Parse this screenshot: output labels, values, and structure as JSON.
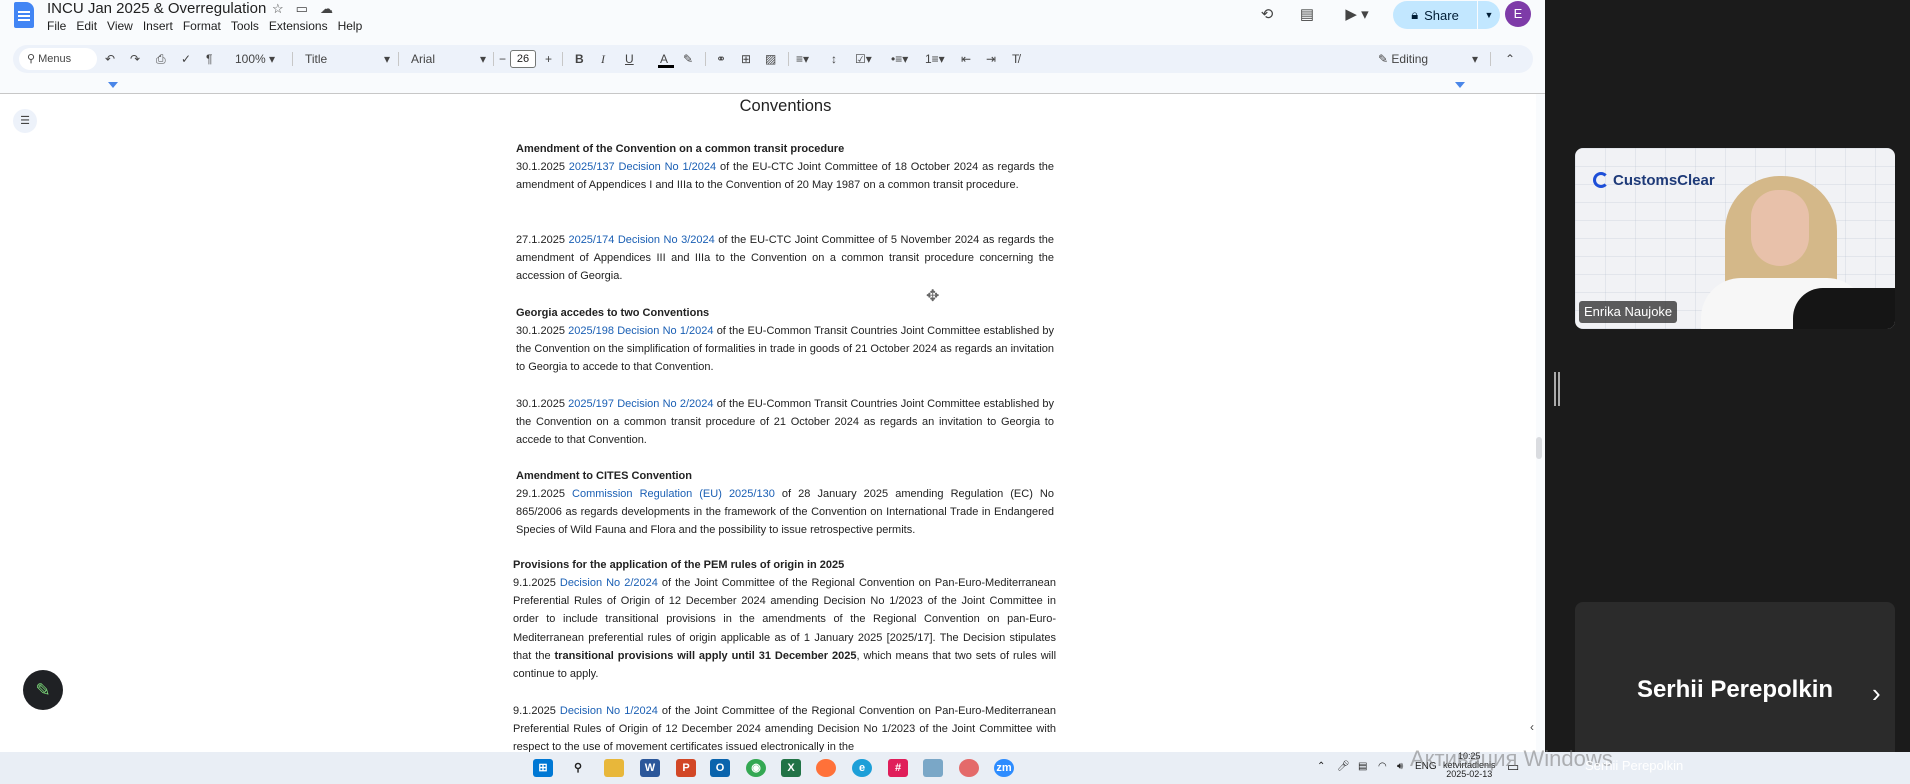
{
  "window": {
    "title": "INCU Jan 2025 & Overregulation",
    "menu": [
      "File",
      "Edit",
      "View",
      "Insert",
      "Format",
      "Tools",
      "Extensions",
      "Help"
    ],
    "share_label": "Share",
    "avatar_letter": "E"
  },
  "toolbar": {
    "menus_label": "Menus",
    "zoom": "100%",
    "style": "Title",
    "font": "Arial",
    "font_size": "26",
    "mode": "Editing"
  },
  "document": {
    "heading": "Conventions",
    "sections": [
      {
        "title": "Amendment of the Convention on a common transit procedure",
        "entries": [
          {
            "date": "30.1.2025",
            "link": "2025/137 Decision No 1/2024",
            "text": "of the EU-CTC Joint Committee of 18 October 2024 as regards the amendment of Appendices I and IIIa to the Convention of 20 May 1987 on a common transit procedure."
          },
          {
            "date": "27.1.2025",
            "link": "2025/174 Decision No 3/2024",
            "text": "of the EU-CTC Joint Committee of 5 November 2024 as regards the amendment of Appendices III and IIIa to the Convention on a common transit procedure concerning the accession of Georgia."
          }
        ]
      },
      {
        "title": "Georgia accedes to two Conventions",
        "entries": [
          {
            "date": "30.1.2025",
            "link": "2025/198 Decision No 1/2024",
            "text": "of the EU-Common Transit Countries Joint Committee established by the Convention on the simplification of formalities in trade in goods of 21 October 2024 as regards an invitation to Georgia to accede to that Convention."
          },
          {
            "date": "30.1.2025",
            "link": "2025/197 Decision No 2/2024",
            "text": "of the EU-Common Transit Countries Joint Committee established by the Convention on a common transit procedure of 21 October 2024 as regards an invitation to Georgia to accede to that Convention."
          }
        ]
      },
      {
        "title": "Amendment to CITES Convention",
        "entries": [
          {
            "date": "29.1.2025",
            "link": "Commission Regulation (EU) 2025/130",
            "text": "of 28 January 2025 amending Regulation (EC) No 865/2006 as regards developments in the framework of the Convention on International Trade in Endangered Species of Wild Fauna and Flora and the possibility to issue retrospective permits."
          }
        ]
      },
      {
        "title": "Provisions for the application of the PEM rules of origin in 2025",
        "entries": [
          {
            "date": "9.1.2025",
            "link": "Decision No 2/2024",
            "text": "of the Joint Committee of the Regional Convention on Pan-Euro-Mediterranean Preferential Rules of Origin of 12 December 2024 amending Decision No 1/2023 of the Joint Committee in order to include transitional provisions in the amendments of the Regional Convention on pan-Euro-Mediterranean preferential rules of origin applicable as of 1 January 2025 [2025/17]. The Decision stipulates that the",
            "bold": "transitional provisions will apply until 31 December 2025",
            "tail": ", which means that two sets of rules will continue to apply."
          },
          {
            "date": "9.1.2025",
            "link": "Decision No 1/2024",
            "text": "of the Joint Committee of the Regional Convention on Pan-Euro-Mediterranean Preferential Rules of Origin of 12 December 2024 amending Decision No 1/2023 of the Joint Committee with respect to the use of movement certificates issued electronically in the"
          }
        ]
      }
    ]
  },
  "meeting": {
    "speaker_name": "Enrika Naujoke",
    "brand": "CustomsClear",
    "participant_name": "Serhii Perepolkin",
    "participant_small": "Serhii Perepolkin"
  },
  "taskbar": {
    "lang": "ENG",
    "time": "10:25",
    "day": "ketvirtadienis",
    "date": "2025-02-13",
    "watermark": "Активация Windows"
  }
}
